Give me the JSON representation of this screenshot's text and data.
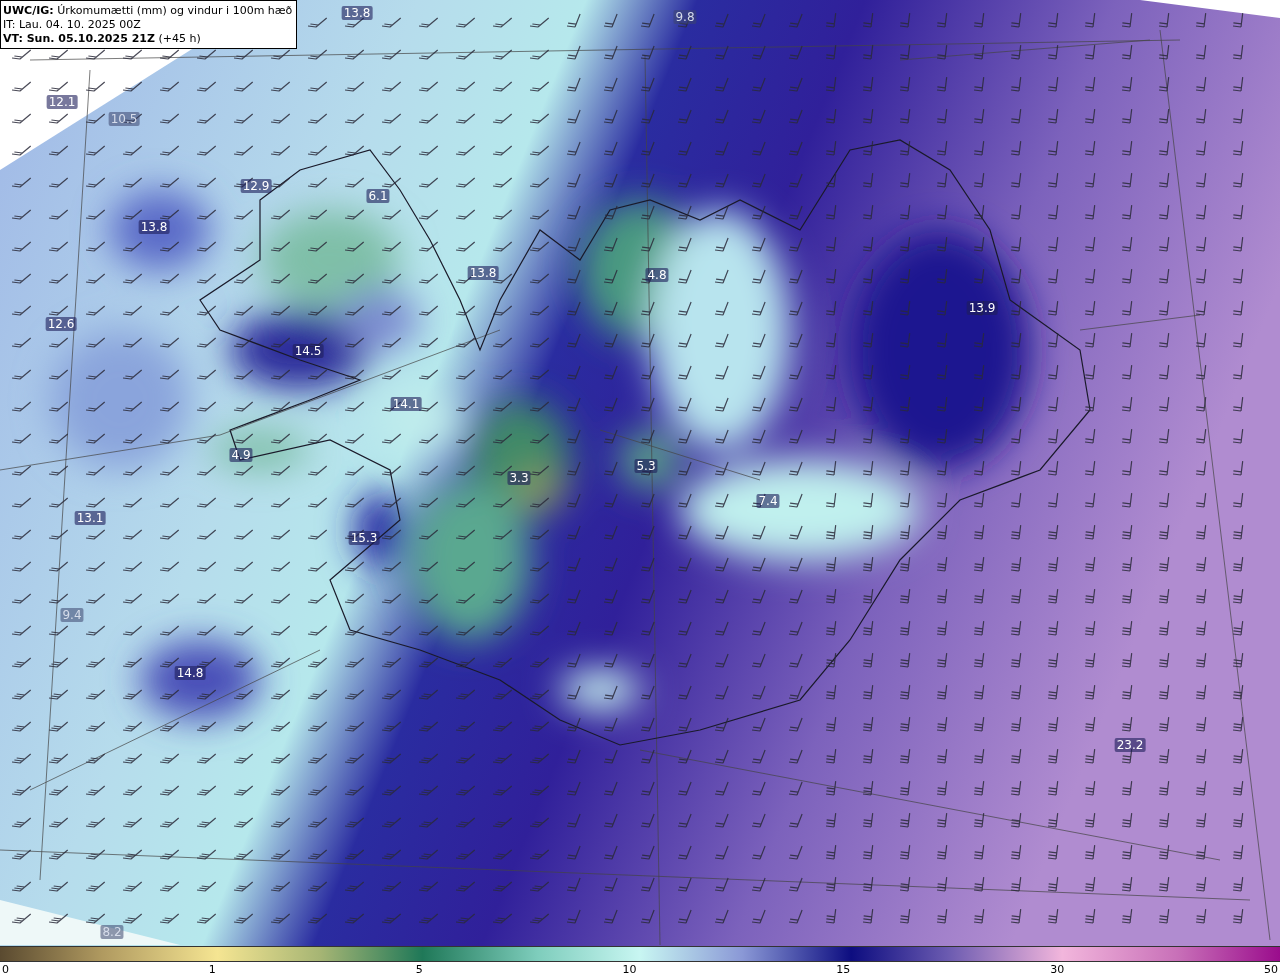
{
  "header": {
    "lines": [
      "**UWC/IG:** Úrkomumætti (mm) og vindur i 100m hæð",
      "IT: Lau. 04. 10. 2025 00Z",
      "**VT: Sun. 05.10.2025 21Z** (+45 h)"
    ]
  },
  "map": {
    "value_labels": [
      {
        "text": "13.8",
        "muted": false
      },
      {
        "text": "9.8",
        "muted": true
      },
      {
        "text": "12.1",
        "muted": false
      },
      {
        "text": "10.5",
        "muted": true
      },
      {
        "text": "12.9",
        "muted": false
      },
      {
        "text": "6.1",
        "muted": false
      },
      {
        "text": "13.8",
        "muted": false
      },
      {
        "text": "13.8",
        "muted": false
      },
      {
        "text": "4.8",
        "muted": false
      },
      {
        "text": "12.6",
        "muted": false
      },
      {
        "text": "14.5",
        "muted": false
      },
      {
        "text": "13.9",
        "muted": false
      },
      {
        "text": "14.1",
        "muted": false
      },
      {
        "text": "4.9",
        "muted": false
      },
      {
        "text": "3.3",
        "muted": false
      },
      {
        "text": "5.3",
        "muted": false
      },
      {
        "text": "7.4",
        "muted": false
      },
      {
        "text": "13.1",
        "muted": false
      },
      {
        "text": "15.3",
        "muted": false
      },
      {
        "text": "9.4",
        "muted": true
      },
      {
        "text": "14.8",
        "muted": false
      },
      {
        "text": "23.2",
        "muted": false
      },
      {
        "text": "8.2",
        "muted": true
      }
    ]
  },
  "colorbar": {
    "ticks": [
      "0",
      "1",
      "5",
      "10",
      "15",
      "30",
      "50"
    ]
  }
}
